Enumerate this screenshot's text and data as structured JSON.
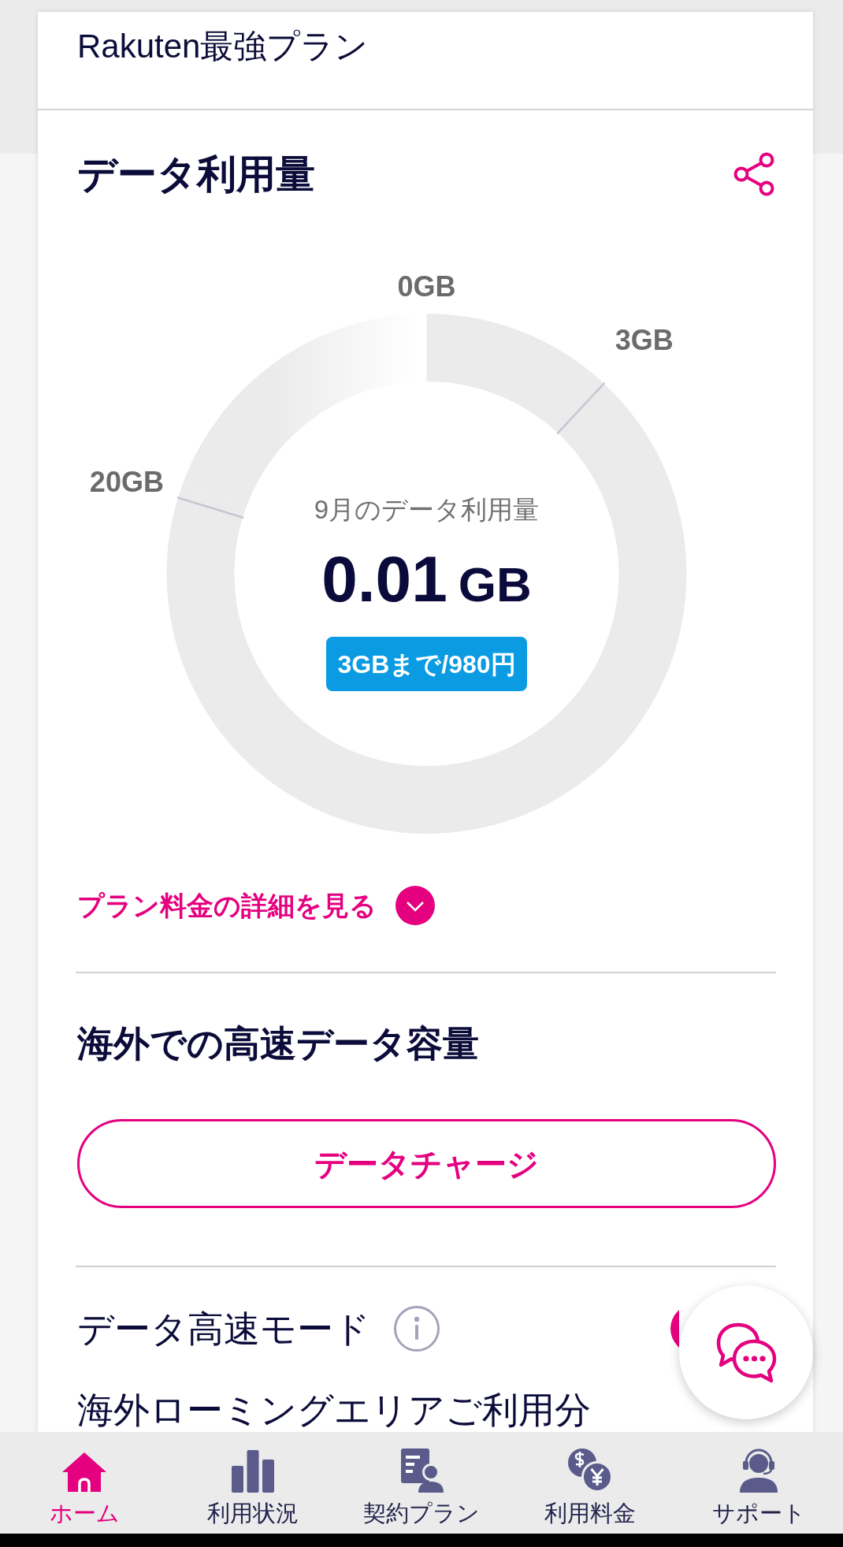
{
  "plan": {
    "name": "Rakuten最強プラン"
  },
  "data_usage": {
    "title": "データ利用量",
    "gauge": {
      "ticks": [
        {
          "label": "0GB"
        },
        {
          "label": "3GB"
        },
        {
          "label": "20GB"
        }
      ],
      "caption": "9月のデータ利用量",
      "value": "0.01",
      "unit": "GB",
      "badge": "3GBまで/980円"
    },
    "details_link": {
      "label": "プラン料金の詳細を見る",
      "expanded": false
    }
  },
  "overseas": {
    "title": "海外での高速データ容量",
    "button": "データチャージ"
  },
  "high_speed_mode": {
    "label": "データ高速モード",
    "on": true
  },
  "roaming": {
    "label": "海外ローミングエリアご利用分"
  },
  "bottom_nav": [
    {
      "label": "ホーム",
      "kind": "home",
      "selected": true
    },
    {
      "label": "利用状況",
      "kind": "usage",
      "selected": false
    },
    {
      "label": "契約プラン",
      "kind": "contract",
      "selected": false
    },
    {
      "label": "利用料金",
      "kind": "billing",
      "selected": false
    },
    {
      "label": "サポート",
      "kind": "support",
      "selected": false
    }
  ]
}
